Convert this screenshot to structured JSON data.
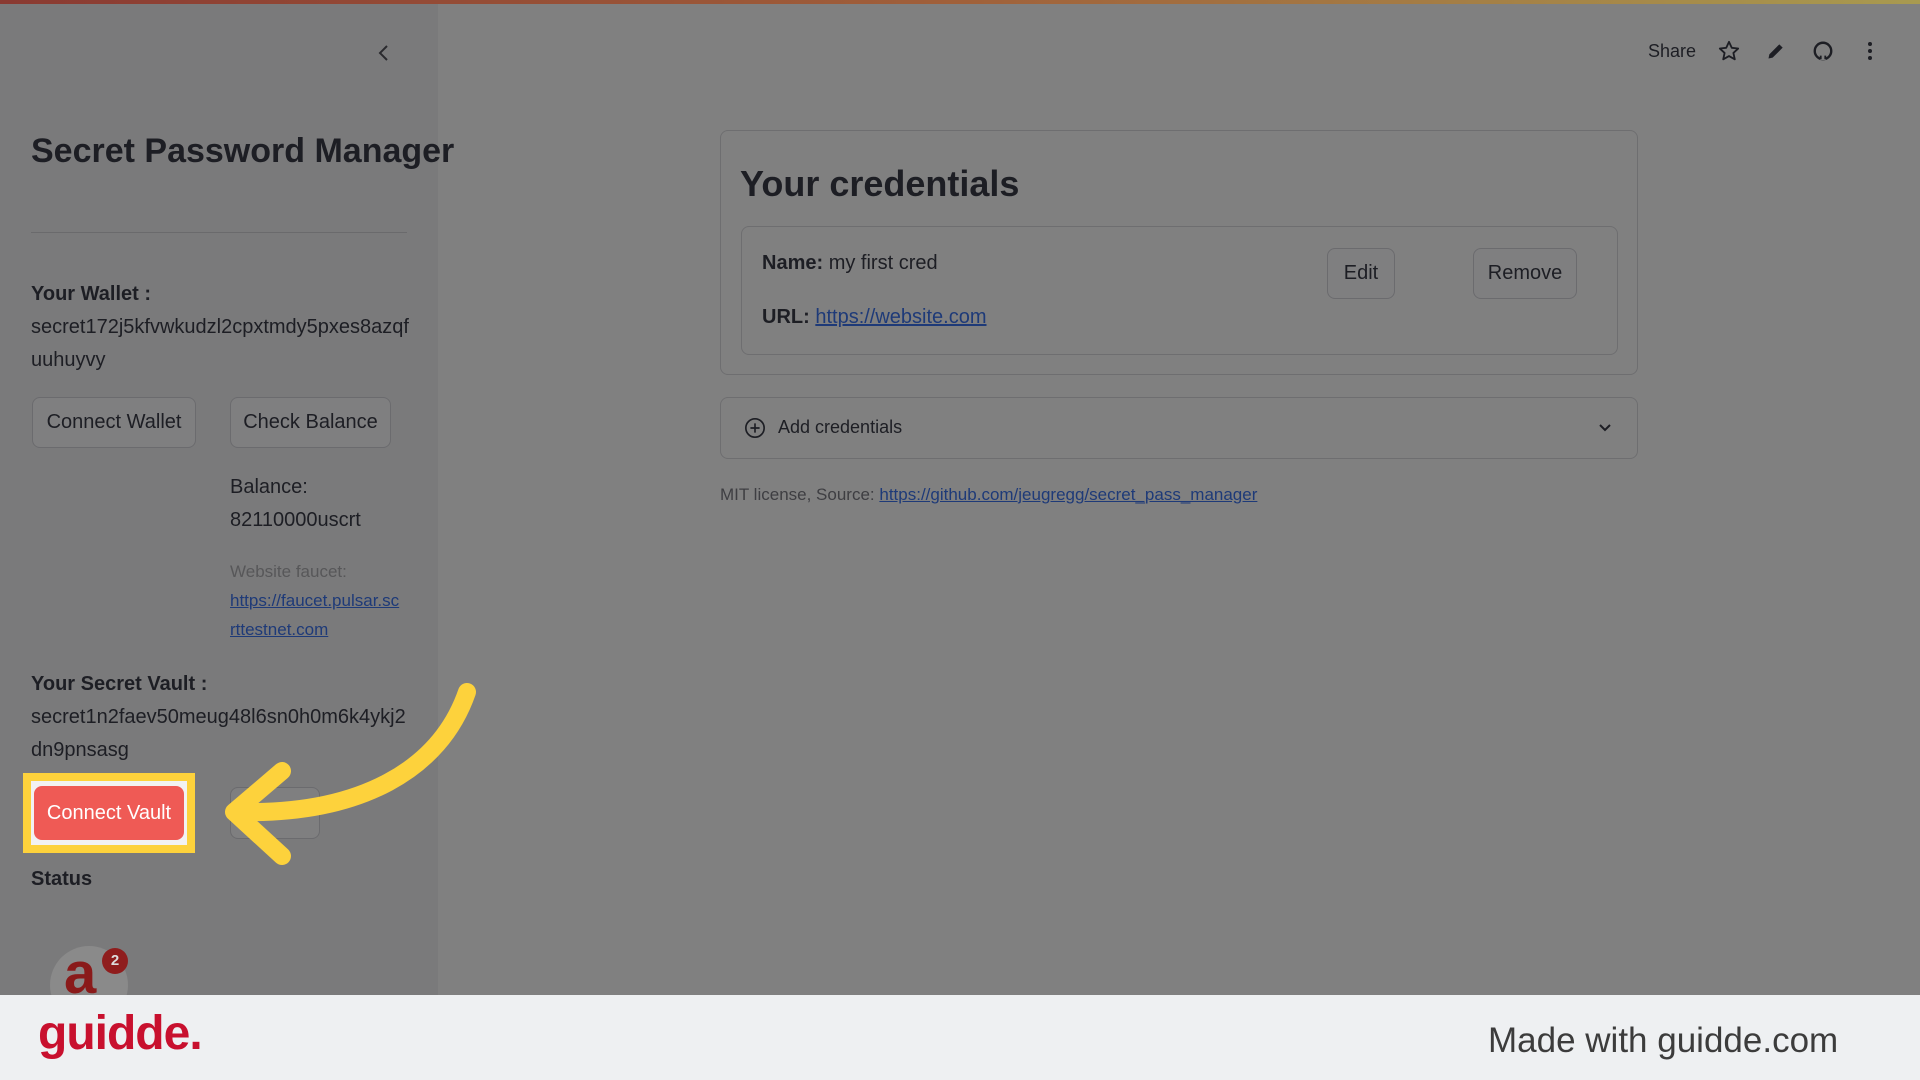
{
  "sidebar": {
    "title": "Secret Password Manager",
    "wallet_label": "Your Wallet :",
    "wallet_address": [
      "secret172j5kfvwkudzl2cpxtmdy5pxes8azqf",
      "uuhuyvy"
    ],
    "connect_wallet": "Connect Wallet",
    "check_balance": "Check Balance",
    "balance_label": "Balance:",
    "balance_value": "82110000uscrt",
    "faucet_label": "Website faucet:",
    "faucet_link": [
      "https://faucet.pulsar.sc",
      "rttestnet.com"
    ],
    "vault_label": "Your Secret Vault :",
    "vault_address": [
      "secret1n2faev50meug48l6sn0h0m6k4ykj2",
      "dn9pnsasg"
    ],
    "connect_vault": "Connect Vault",
    "status_label": "Status",
    "avatar_badge": "2"
  },
  "header": {
    "share": "Share",
    "icons": [
      "star-icon",
      "pencil-icon",
      "github-icon",
      "more-vertical-icon"
    ]
  },
  "main": {
    "title": "Your credentials",
    "credential": {
      "name_label": "Name:",
      "name_value": "my first cred",
      "url_label": "URL:",
      "url_value": "https://website.com",
      "edit": "Edit",
      "remove": "Remove"
    },
    "add_credentials": "Add credentials",
    "license_text": "MIT license, Source:",
    "license_link": "https://github.com/jeugregg/secret_pass_manager"
  },
  "footer": {
    "logo": "guidde.",
    "made_with": "Made with guidde.com"
  },
  "colors": {
    "highlight": "#fdd23c",
    "primary_button": "#ef5a55",
    "logo": "#c8102e"
  }
}
